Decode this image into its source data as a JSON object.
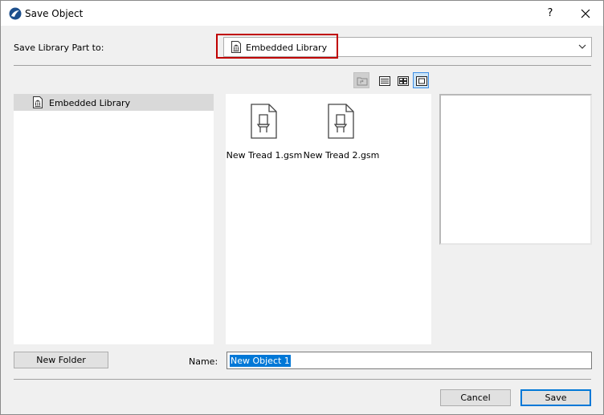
{
  "window": {
    "title": "Save Object",
    "help_label": "?",
    "close_label": "✕"
  },
  "destination": {
    "label": "Save Library Part to:",
    "value": "Embedded Library"
  },
  "view_modes": [
    "parent-folder",
    "list-view",
    "small-icons-view",
    "large-icons-view"
  ],
  "tree": {
    "items": [
      {
        "label": "Embedded Library",
        "icon": "library-icon",
        "selected": true
      }
    ]
  },
  "files": [
    {
      "name": "New Tread 1.gsm",
      "icon": "object-file-icon"
    },
    {
      "name": "New Tread 2.gsm",
      "icon": "object-file-icon"
    }
  ],
  "new_folder_label": "New Folder",
  "name_field": {
    "label": "Name:",
    "value": "New Object 1"
  },
  "buttons": {
    "cancel": "Cancel",
    "save": "Save"
  },
  "colors": {
    "highlight_box": "#c00000",
    "selection": "#0078d7",
    "active_view": "#cce4f7"
  }
}
